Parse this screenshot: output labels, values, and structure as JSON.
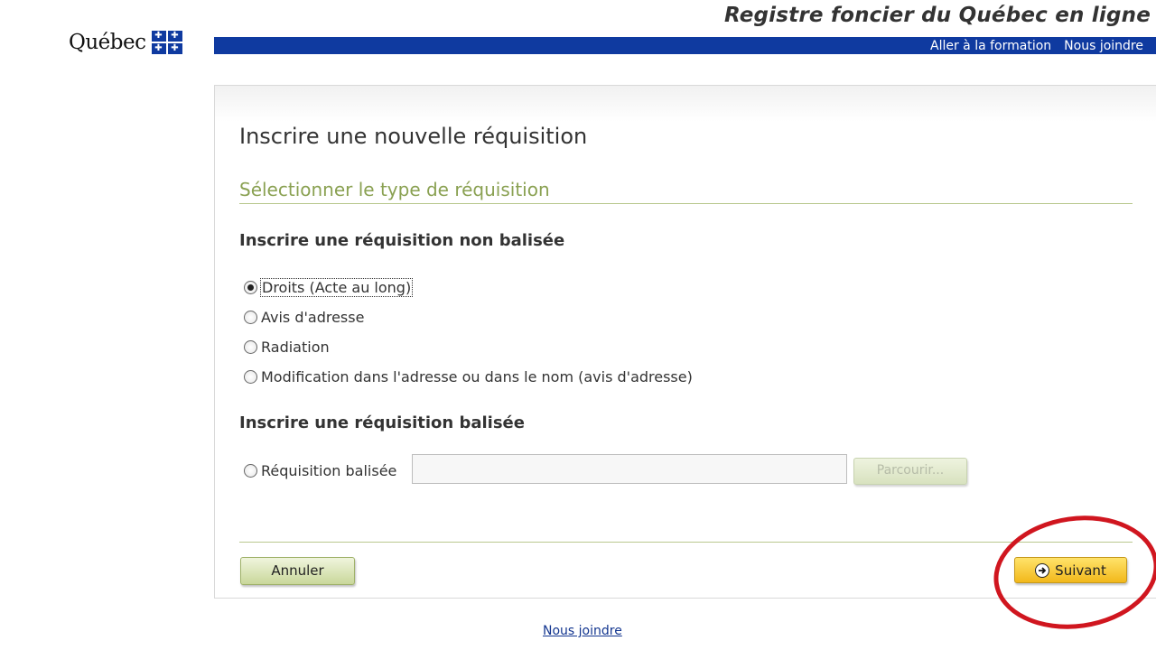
{
  "header": {
    "site_title": "Registre foncier du Québec en ligne",
    "logo_text": "Québec",
    "links": [
      "Aller à la formation",
      "Nous joindre"
    ]
  },
  "page": {
    "title": "Inscrire une nouvelle réquisition",
    "section_title": "Sélectionner le type de réquisition"
  },
  "group_unmarked": {
    "title": "Inscrire une réquisition non balisée",
    "options": [
      {
        "label": "Droits (Acte au long)",
        "checked": true
      },
      {
        "label": "Avis d'adresse",
        "checked": false
      },
      {
        "label": "Radiation",
        "checked": false
      },
      {
        "label": "Modification dans l'adresse ou dans le nom (avis d'adresse)",
        "checked": false
      }
    ]
  },
  "group_marked": {
    "title": "Inscrire une réquisition balisée",
    "option_label": "Réquisition balisée",
    "file_value": "",
    "browse_label": "Parcourir..."
  },
  "actions": {
    "cancel_label": "Annuler",
    "next_label": "Suivant"
  },
  "footer": {
    "link": "Nous joindre"
  },
  "colors": {
    "brand_blue": "#0f3aa0",
    "section_green": "#8aa152",
    "next_button": "#f2b81b",
    "annotation_red": "#d0161f"
  }
}
